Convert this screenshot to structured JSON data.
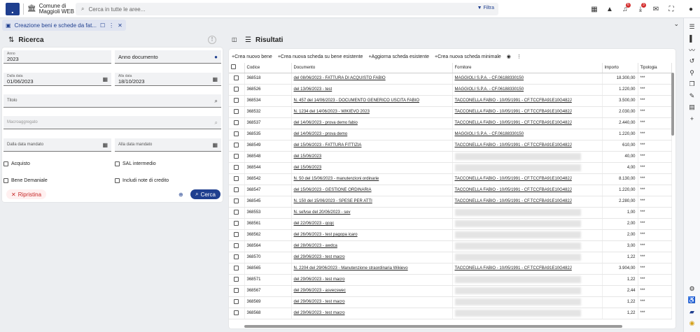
{
  "app": {
    "org_line1": "Comune di",
    "org_line2": "Maggioli WEB"
  },
  "search": {
    "placeholder": "Cerca in tutte le aree...",
    "filter_label": "Filtra"
  },
  "top_icons": [
    {
      "name": "dashboard-icon",
      "glyph": "▦",
      "badge": ""
    },
    {
      "name": "warning-icon",
      "glyph": "▲",
      "badge": ""
    },
    {
      "name": "bell-icon",
      "glyph": "🔔",
      "badge": "6"
    },
    {
      "name": "download-icon",
      "glyph": "⤓",
      "badge": "3"
    },
    {
      "name": "mail-icon",
      "glyph": "✉",
      "badge": ""
    },
    {
      "name": "fullscreen-icon",
      "glyph": "⛶",
      "badge": ""
    },
    {
      "name": "user-icon",
      "glyph": "●",
      "badge": ""
    }
  ],
  "tab": {
    "label": "Creazione beni e schede da fat..."
  },
  "ricerca": {
    "title": "Ricerca",
    "anno_label": "Anno",
    "anno_value": "2023",
    "anno_documento": "Anno documento",
    "dalla_data_label": "Dalla data",
    "dalla_data_value": "01/06/2023",
    "alla_data_label": "Alla data",
    "alla_data_value": "18/10/2023",
    "titolo": "Titolo",
    "macroaggregato": "Macroaggregato",
    "dalla_data_mandato": "Dalla data mandato",
    "alla_data_mandato": "Alla data mandato",
    "acquisto": "Acquisto",
    "sal": "SAL intermedio",
    "bene_demaniale": "Bene Demaniale",
    "note_credito": "Includi note di credito",
    "ripristina": "Ripristina",
    "cerca": "Cerca"
  },
  "risultati": {
    "title": "Risultati",
    "actions": [
      "Crea nuovo bene",
      "Crea nuova scheda su bene esistente",
      "Aggiorna scheda esistente",
      "Crea nuova scheda minimale"
    ],
    "columns": [
      "Codice",
      "Documento",
      "Fornitore",
      "Importo",
      "Tipologia"
    ],
    "rows": [
      {
        "codice": "368518",
        "documento": "del 08/06/2023 - FATTURA DI ACQUISTO FABIO",
        "fornitore": "MAGGIOLI S.P.A. - CF.06188330150",
        "importo": "18.300,00",
        "tipologia": "***"
      },
      {
        "codice": "368526",
        "documento": "del 13/06/2023 - test",
        "fornitore": "MAGGIOLI S.P.A. - CF.06188330150",
        "importo": "1.220,00",
        "tipologia": "***"
      },
      {
        "codice": "368534",
        "documento": "N. 457 del 14/06/2023 - DOCUMENTO GENERICO USCITA FABIO",
        "fornitore": "TACCONELLA FABIO - 10/05/1991 - CF.TCCFBA91E10G482J",
        "importo": "3.500,00",
        "tipologia": "***"
      },
      {
        "codice": "368532",
        "documento": "N. 1234 del 14/06/2023 - WIKIEVO 2023",
        "fornitore": "TACCONELLA FABIO - 10/05/1991 - CF.TCCFBA91E10G482J",
        "importo": "2.030,00",
        "tipologia": "***"
      },
      {
        "codice": "368537",
        "documento": "del 14/06/2023 - prova demo fabio",
        "fornitore": "TACCONELLA FABIO - 10/05/1991 - CF.TCCFBA91E10G482J",
        "importo": "2.440,00",
        "tipologia": "***"
      },
      {
        "codice": "368535",
        "documento": "del 14/06/2023 - prova demo",
        "fornitore": "MAGGIOLI S.P.A. - CF.06188330150",
        "importo": "1.220,00",
        "tipologia": "***"
      },
      {
        "codice": "368549",
        "documento": "del 15/06/2023 - FATTURA FITTIZIA",
        "fornitore": "TACCONELLA FABIO - 10/05/1991 - CF.TCCFBA91E10G482J",
        "importo": "610,00",
        "tipologia": "***"
      },
      {
        "codice": "368548",
        "documento": "del 15/06/2023",
        "fornitore": "",
        "importo": "40,00",
        "tipologia": "***"
      },
      {
        "codice": "368544",
        "documento": "del 15/06/2023",
        "fornitore": "",
        "importo": "4,00",
        "tipologia": "***"
      },
      {
        "codice": "368542",
        "documento": "N. 50 del 15/06/2023 - manutenzioni ordinarie",
        "fornitore": "TACCONELLA FABIO - 10/05/1991 - CF.TCCFBA91E10G482J",
        "importo": "8.130,00",
        "tipologia": "***"
      },
      {
        "codice": "368547",
        "documento": "del 15/06/2023 - GESTIONE ORDINARIA",
        "fornitore": "TACCONELLA FABIO - 10/05/1991 - CF.TCCFBA91E10G482J",
        "importo": "1.220,00",
        "tipologia": "***"
      },
      {
        "codice": "368545",
        "documento": "N. 150 del 15/06/2023 - SPESE PER ATTI",
        "fornitore": "TACCONELLA FABIO - 10/05/1991 - CF.TCCFBA91E10G482J",
        "importo": "2.280,00",
        "tipologia": "***"
      },
      {
        "codice": "368553",
        "documento": "N. sefvse del 20/06/2023 - sev",
        "fornitore": "",
        "importo": "1,00",
        "tipologia": "***"
      },
      {
        "codice": "368561",
        "documento": "del 22/06/2023 - qcqc",
        "fornitore": "",
        "importo": "2,00",
        "tipologia": "***"
      },
      {
        "codice": "368562",
        "documento": "del 26/06/2023 - test pagopa icaro",
        "fornitore": "",
        "importo": "2,00",
        "tipologia": "***"
      },
      {
        "codice": "368564",
        "documento": "del 28/06/2023 - awdca",
        "fornitore": "",
        "importo": "3,00",
        "tipologia": "***"
      },
      {
        "codice": "368570",
        "documento": "del 29/06/2023 - test macro",
        "fornitore": "",
        "importo": "1,22",
        "tipologia": "***"
      },
      {
        "codice": "368565",
        "documento": "N. 2204 del 29/06/2023 - Manutenzione straordinaria Wikievo",
        "fornitore": "TACCONELLA FABIO - 10/05/1991 - CF.TCCFBA91E10G482J",
        "importo": "3.904,00",
        "tipologia": "***"
      },
      {
        "codice": "368571",
        "documento": "del 29/06/2023 - test macro",
        "fornitore": "",
        "importo": "1,22",
        "tipologia": "***"
      },
      {
        "codice": "368567",
        "documento": "del 29/06/2023 - asvecswec",
        "fornitore": "",
        "importo": "2,44",
        "tipologia": "***"
      },
      {
        "codice": "368569",
        "documento": "del 29/06/2023 - test macro",
        "fornitore": "",
        "importo": "1,22",
        "tipologia": "***"
      },
      {
        "codice": "368568",
        "documento": "del 29/06/2023 - test macro",
        "fornitore": "",
        "importo": "1,22",
        "tipologia": "***"
      }
    ]
  },
  "right_sidebar": [
    "list-settings-icon",
    "book-icon",
    "trend-icon",
    "history-icon",
    "pin-icon",
    "copy-icon",
    "edit-doc-icon",
    "document-icon",
    "plus-icon"
  ],
  "right_sidebar_bottom": [
    "gear-icon",
    "accessibility-icon",
    "chat-icon",
    "help-icon"
  ],
  "colors": {
    "accent": "#1f3f8f",
    "danger": "#c62828"
  }
}
